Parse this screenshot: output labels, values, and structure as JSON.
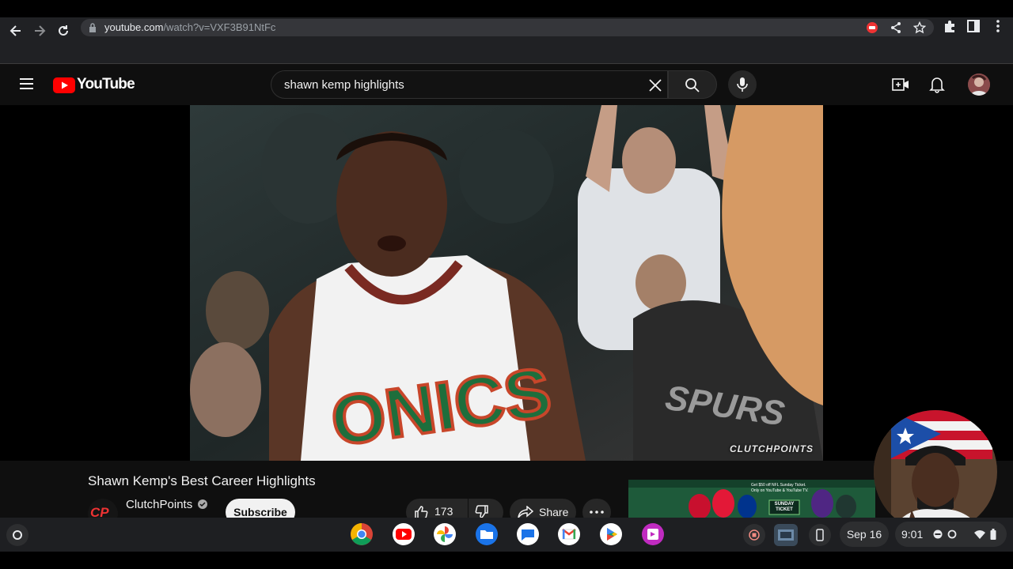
{
  "browser": {
    "url_host": "youtube.com",
    "url_path": "/watch?v=VXF3B91NtFc"
  },
  "youtube": {
    "logo_text": "YouTube",
    "search_query": "shawn kemp highlights"
  },
  "video": {
    "watermark": "CLUTCHPOINTS",
    "title": "Shawn Kemp's Best Career Highlights",
    "channel_name": "ClutchPoints",
    "channel_avatar_text": "CP",
    "subscribe_label": "Subscribe",
    "like_count": "173",
    "share_label": "Share"
  },
  "ad": {
    "lines": [
      "Get $50 off NFL Sunday Ticket.",
      "Only on YouTube & YouTube TV."
    ],
    "badge": [
      "SUNDAY",
      "TICKET"
    ]
  },
  "shelf": {
    "date": "Sep 16",
    "time": "9:01",
    "apps": [
      "chrome-icon",
      "youtube-icon",
      "photos-icon",
      "files-icon",
      "messages-icon",
      "gmail-icon",
      "play-store-icon",
      "screencast-icon"
    ]
  },
  "colors": {
    "youtube_red": "#ff0000",
    "chrome_bg": "#202124",
    "yt_bg": "#0f0f0f"
  }
}
